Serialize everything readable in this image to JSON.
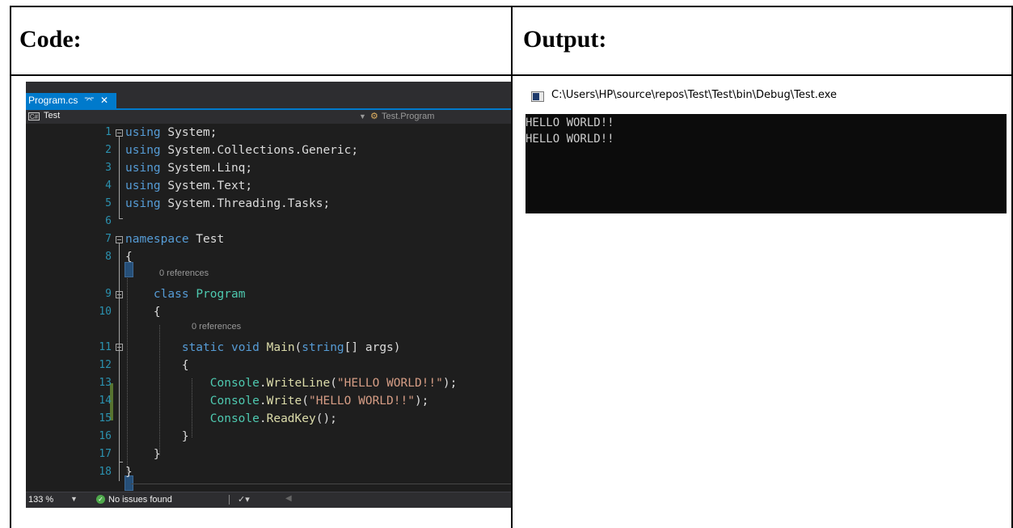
{
  "headers": {
    "code": "Code:",
    "output": "Output:"
  },
  "editor": {
    "tab_label": "Program.cs",
    "tab_pin": "⌤",
    "tab_close": "✕",
    "project": "Test",
    "class_path": "Test.Program",
    "ref_label": "0 references",
    "lines": [
      {
        "n": "1",
        "parts": [
          {
            "c": "kw",
            "t": "using"
          },
          {
            "c": "",
            "t": " System;"
          }
        ]
      },
      {
        "n": "2",
        "parts": [
          {
            "c": "kw",
            "t": "using"
          },
          {
            "c": "",
            "t": " System.Collections.Generic;"
          }
        ]
      },
      {
        "n": "3",
        "parts": [
          {
            "c": "kw",
            "t": "using"
          },
          {
            "c": "",
            "t": " System.Linq;"
          }
        ]
      },
      {
        "n": "4",
        "parts": [
          {
            "c": "kw",
            "t": "using"
          },
          {
            "c": "",
            "t": " System.Text;"
          }
        ]
      },
      {
        "n": "5",
        "parts": [
          {
            "c": "kw",
            "t": "using"
          },
          {
            "c": "",
            "t": " System.Threading.Tasks;"
          }
        ]
      },
      {
        "n": "6",
        "parts": []
      },
      {
        "n": "7",
        "parts": [
          {
            "c": "kw",
            "t": "namespace"
          },
          {
            "c": "",
            "t": " Test"
          }
        ]
      },
      {
        "n": "8",
        "parts": [
          {
            "c": "",
            "t": "{"
          }
        ]
      },
      {
        "n": "9",
        "parts": [
          {
            "c": "",
            "t": "    "
          },
          {
            "c": "kw",
            "t": "class"
          },
          {
            "c": "",
            "t": " "
          },
          {
            "c": "ty",
            "t": "Program"
          }
        ]
      },
      {
        "n": "10",
        "parts": [
          {
            "c": "",
            "t": "    {"
          }
        ]
      },
      {
        "n": "11",
        "parts": [
          {
            "c": "",
            "t": "        "
          },
          {
            "c": "kw",
            "t": "static"
          },
          {
            "c": "",
            "t": " "
          },
          {
            "c": "kw",
            "t": "void"
          },
          {
            "c": "",
            "t": " "
          },
          {
            "c": "fn",
            "t": "Main"
          },
          {
            "c": "",
            "t": "("
          },
          {
            "c": "kw",
            "t": "string"
          },
          {
            "c": "",
            "t": "[] args)"
          }
        ]
      },
      {
        "n": "12",
        "parts": [
          {
            "c": "",
            "t": "        {"
          }
        ]
      },
      {
        "n": "13",
        "parts": [
          {
            "c": "",
            "t": "            "
          },
          {
            "c": "ty",
            "t": "Console"
          },
          {
            "c": "",
            "t": "."
          },
          {
            "c": "fn",
            "t": "WriteLine"
          },
          {
            "c": "",
            "t": "("
          },
          {
            "c": "str",
            "t": "\"HELLO WORLD!!\""
          },
          {
            "c": "",
            "t": ");"
          }
        ]
      },
      {
        "n": "14",
        "parts": [
          {
            "c": "",
            "t": "            "
          },
          {
            "c": "ty",
            "t": "Console"
          },
          {
            "c": "",
            "t": "."
          },
          {
            "c": "fn",
            "t": "Write"
          },
          {
            "c": "",
            "t": "("
          },
          {
            "c": "str",
            "t": "\"HELLO WORLD!!\""
          },
          {
            "c": "",
            "t": ");"
          }
        ]
      },
      {
        "n": "15",
        "parts": [
          {
            "c": "",
            "t": "            "
          },
          {
            "c": "ty",
            "t": "Console"
          },
          {
            "c": "",
            "t": "."
          },
          {
            "c": "fn",
            "t": "ReadKey"
          },
          {
            "c": "",
            "t": "();"
          }
        ]
      },
      {
        "n": "16",
        "parts": [
          {
            "c": "",
            "t": "        }"
          }
        ]
      },
      {
        "n": "17",
        "parts": [
          {
            "c": "",
            "t": "    }"
          }
        ]
      },
      {
        "n": "18",
        "parts": [
          {
            "c": "",
            "t": "}"
          }
        ]
      }
    ],
    "status": {
      "zoom": "133 %",
      "issues": "No issues found"
    },
    "colors": {
      "keyword": "#569cd6",
      "type": "#4ec9b0",
      "method": "#dcdcaa",
      "string": "#d69d85",
      "line_number": "#2b91af",
      "accent": "#007acc"
    }
  },
  "console": {
    "title": "C:\\Users\\HP\\source\\repos\\Test\\Test\\bin\\Debug\\Test.exe",
    "lines": [
      "HELLO WORLD!!",
      "HELLO WORLD!!"
    ]
  }
}
